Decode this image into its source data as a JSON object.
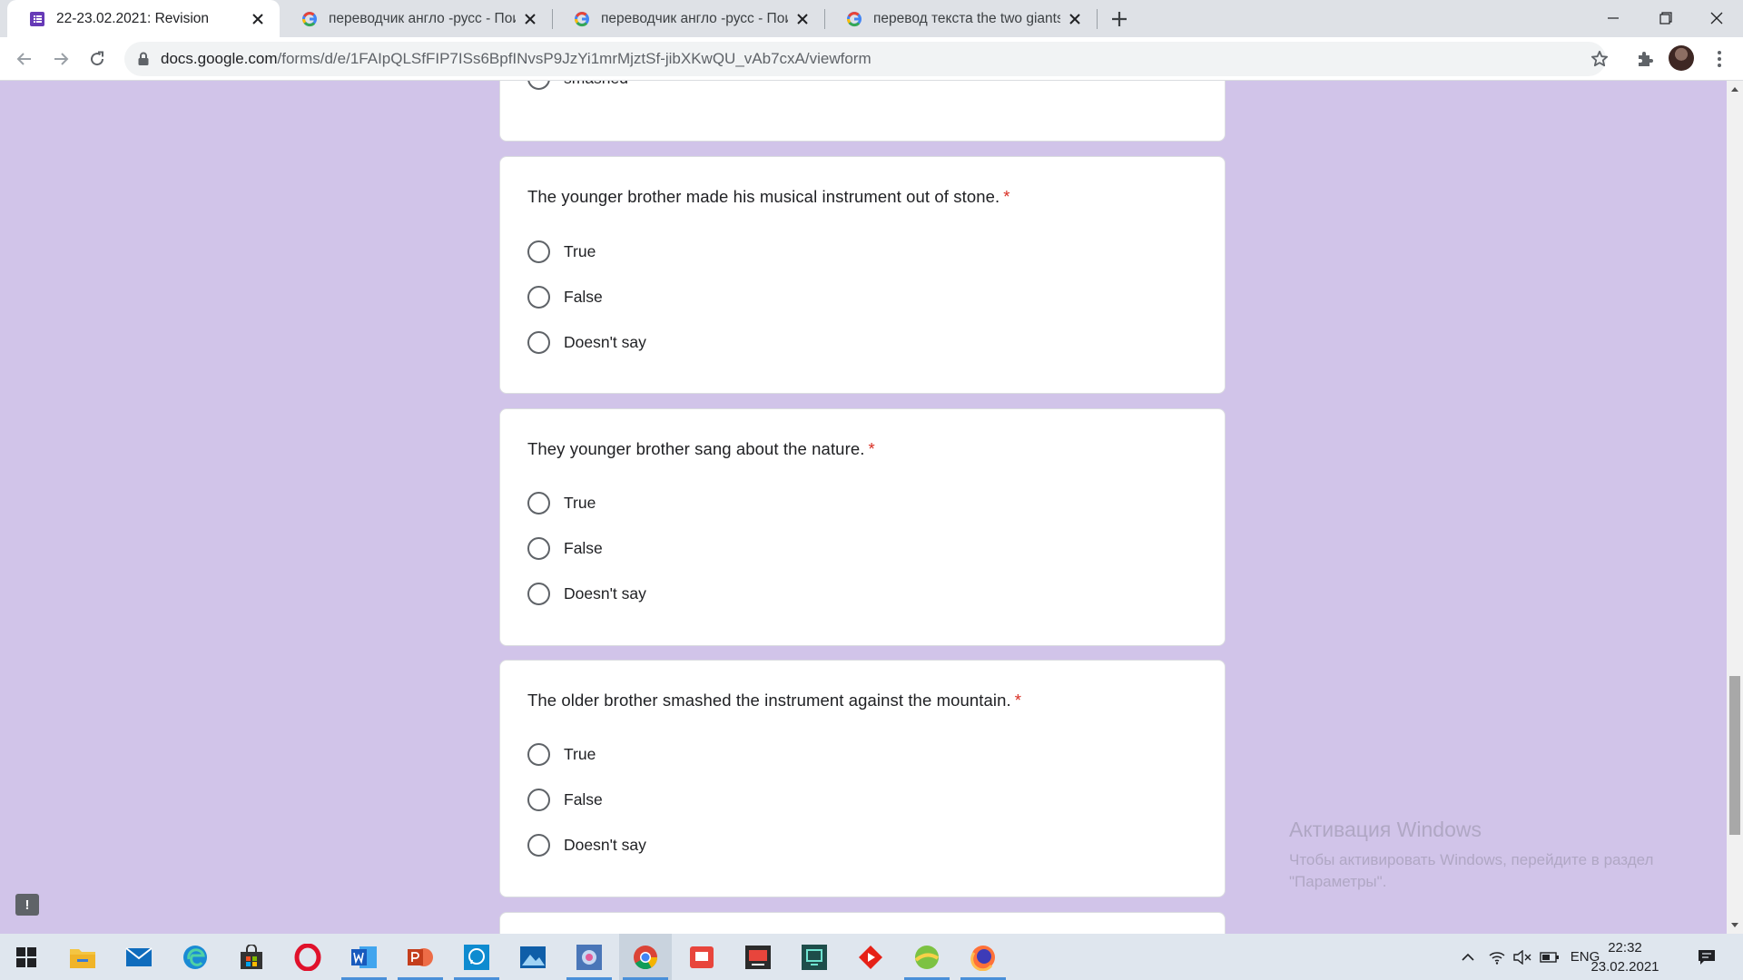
{
  "browser": {
    "tabs": [
      {
        "title": "22-23.02.2021: Revision",
        "favicon": "google-forms-icon",
        "active": true
      },
      {
        "title": "переводчик англо -русс - Поиск",
        "favicon": "google-icon",
        "active": false
      },
      {
        "title": "переводчик англо -русс - Поиск",
        "favicon": "google-icon",
        "active": false
      },
      {
        "title": "перевод текста the two giants -",
        "favicon": "google-icon",
        "active": false
      }
    ],
    "url_host": "docs.google.com",
    "url_path": "/forms/d/e/1FAIpQLSfFIP7ISs6BpfINvsP9JzYi1mrMjztSf-jibXKwQU_vAb7cxA/viewform"
  },
  "form": {
    "previous_option": "smashed",
    "required_mark": "*",
    "questions": [
      {
        "title": "The younger brother made his musical instrument out of stone.",
        "options": [
          "True",
          "False",
          "Doesn't say"
        ]
      },
      {
        "title": "They younger brother sang about the nature.",
        "options": [
          "True",
          "False",
          "Doesn't say"
        ]
      },
      {
        "title": "The older brother smashed the instrument against the mountain.",
        "options": [
          "True",
          "False",
          "Doesn't say"
        ]
      }
    ]
  },
  "watermark": {
    "title": "Активация Windows",
    "text": "Чтобы активировать Windows, перейдите в раздел \"Параметры\"."
  },
  "taskbar": {
    "language": "ENG",
    "time": "22:32",
    "date": "23.02.2021"
  },
  "colors": {
    "page_background": "#d1c4e9",
    "required": "#d93025",
    "taskbar": "#dfe6ee"
  }
}
